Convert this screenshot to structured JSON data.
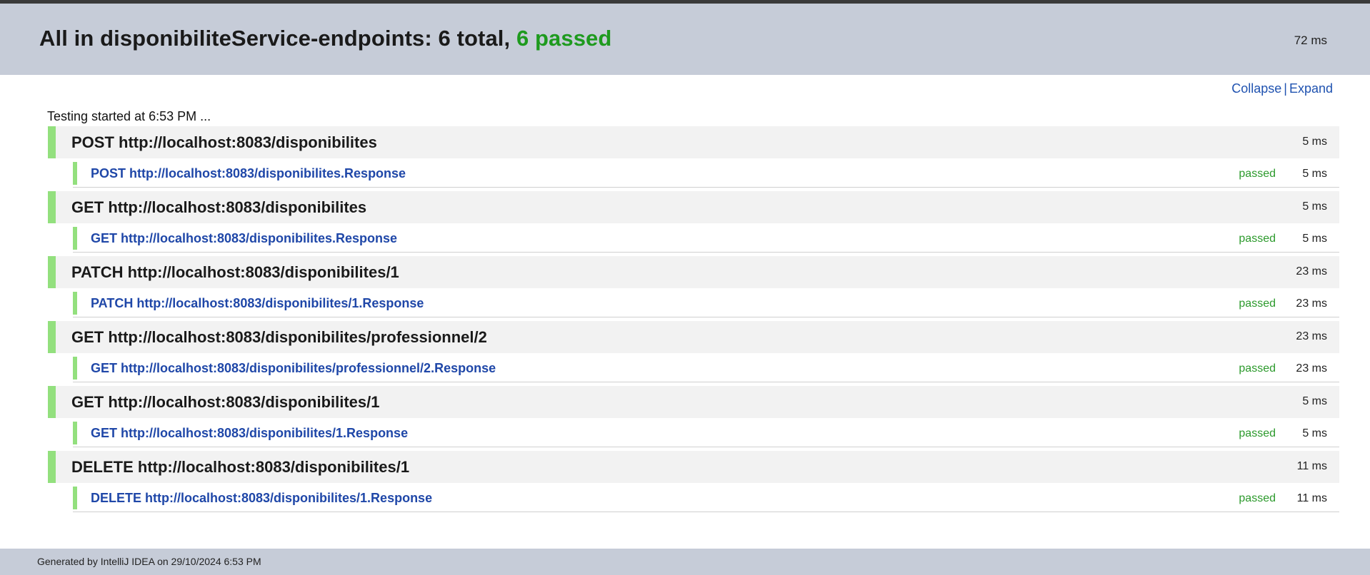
{
  "header": {
    "title_prefix": "All in disponibiliteService-endpoints: 6 total, ",
    "title_passed": "6 passed",
    "duration": "72 ms",
    "colors": {
      "passed": "#1e9a1e",
      "background": "#c6ccd8"
    }
  },
  "toggles": {
    "collapse": "Collapse",
    "separator": "|",
    "expand": "Expand"
  },
  "started": "Testing started at 6:53 PM ...",
  "groups": [
    {
      "name": "POST http://localhost:8083/disponibilites",
      "duration": "5 ms",
      "test": {
        "name": "POST http://localhost:8083/disponibilites.Response",
        "status": "passed",
        "duration": "5 ms"
      }
    },
    {
      "name": "GET http://localhost:8083/disponibilites",
      "duration": "5 ms",
      "test": {
        "name": "GET http://localhost:8083/disponibilites.Response",
        "status": "passed",
        "duration": "5 ms"
      }
    },
    {
      "name": "PATCH http://localhost:8083/disponibilites/1",
      "duration": "23 ms",
      "test": {
        "name": "PATCH http://localhost:8083/disponibilites/1.Response",
        "status": "passed",
        "duration": "23 ms"
      }
    },
    {
      "name": "GET http://localhost:8083/disponibilites/professionnel/2",
      "duration": "23 ms",
      "test": {
        "name": "GET http://localhost:8083/disponibilites/professionnel/2.Response",
        "status": "passed",
        "duration": "23 ms"
      }
    },
    {
      "name": "GET http://localhost:8083/disponibilites/1",
      "duration": "5 ms",
      "test": {
        "name": "GET http://localhost:8083/disponibilites/1.Response",
        "status": "passed",
        "duration": "5 ms"
      }
    },
    {
      "name": "DELETE http://localhost:8083/disponibilites/1",
      "duration": "11 ms",
      "test": {
        "name": "DELETE http://localhost:8083/disponibilites/1.Response",
        "status": "passed",
        "duration": "11 ms"
      }
    }
  ],
  "footer": "Generated by IntelliJ IDEA on 29/10/2024 6:53 PM"
}
